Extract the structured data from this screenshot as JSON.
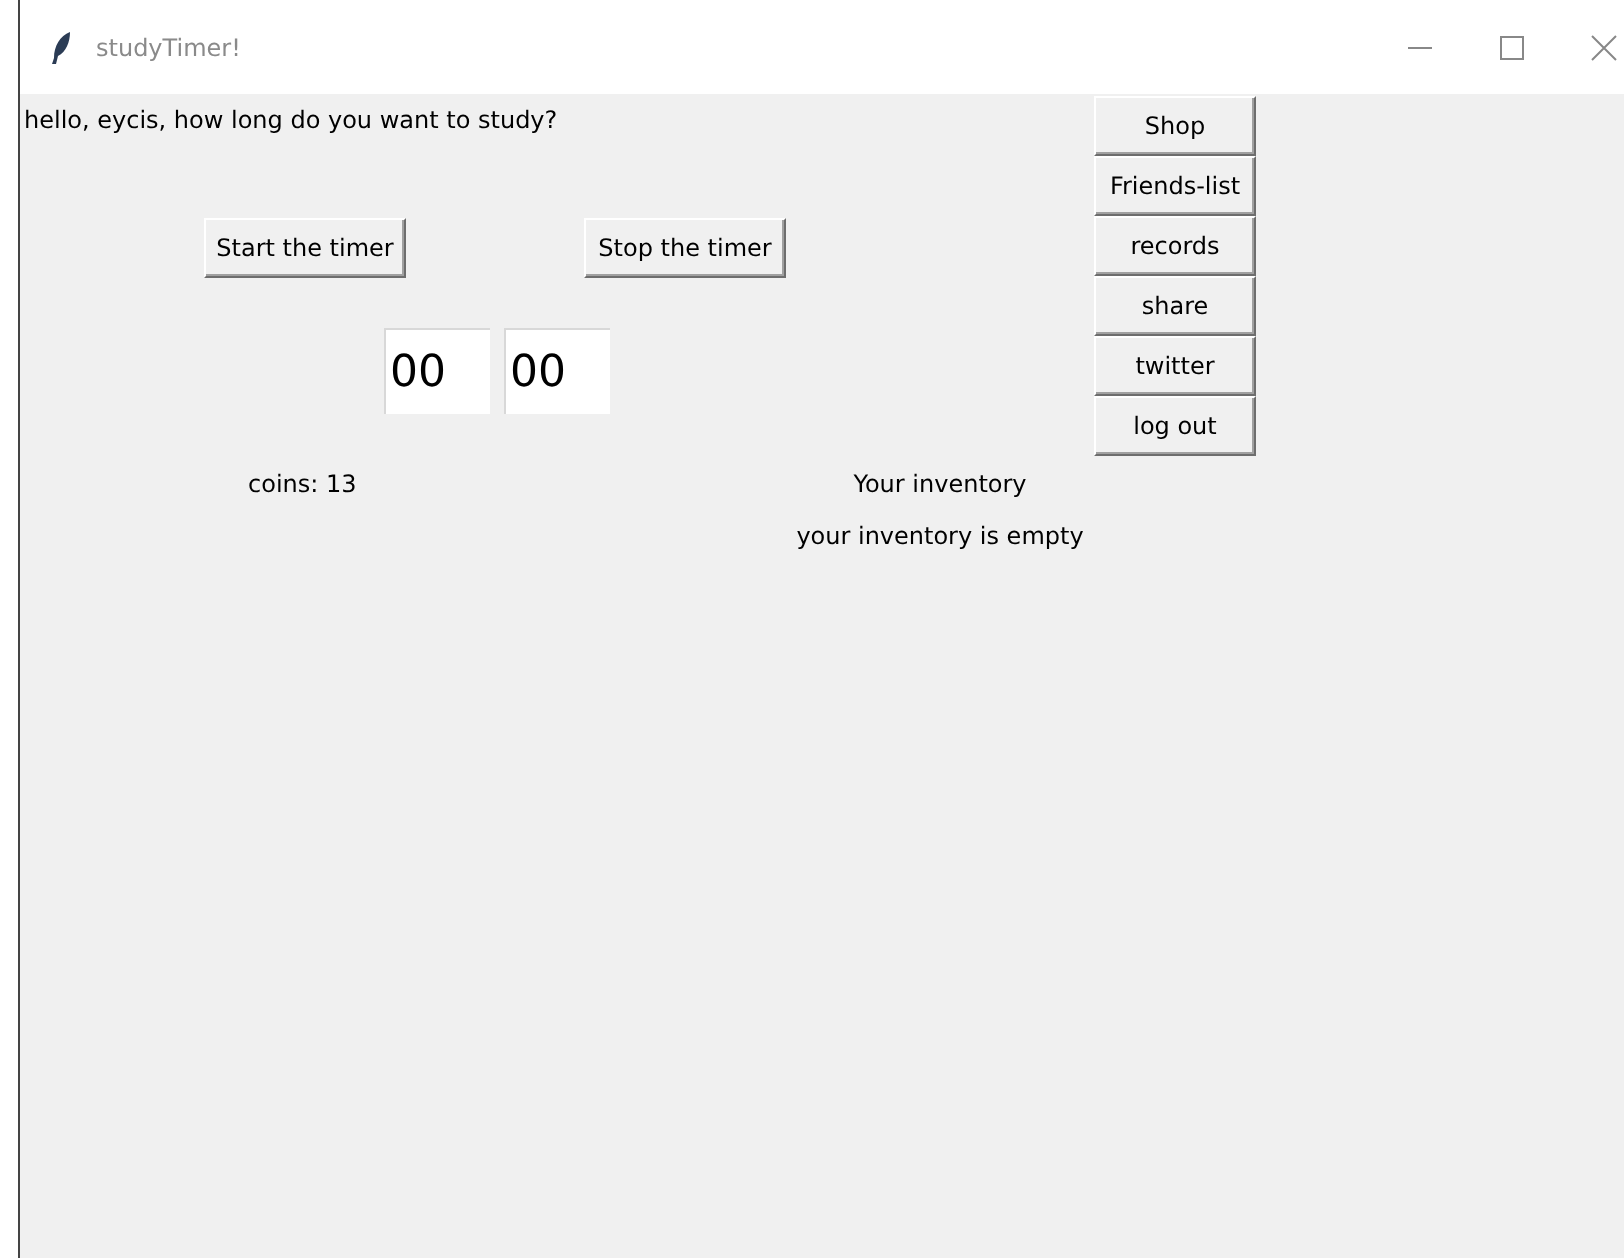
{
  "window": {
    "title": "studyTimer!"
  },
  "greeting": "hello, eycis, how long do you want to study?",
  "timer_buttons": [
    "Start the timer",
    "Stop the timer"
  ],
  "time_fields": [
    {
      "value": "00"
    },
    {
      "value": "00"
    }
  ],
  "coins": "coins: 13",
  "inventory": {
    "title": "Your inventory",
    "status": "your inventory is empty"
  },
  "menu_buttons": [
    "Shop",
    "Friends-list",
    "records",
    "share",
    "twitter",
    "log out"
  ]
}
